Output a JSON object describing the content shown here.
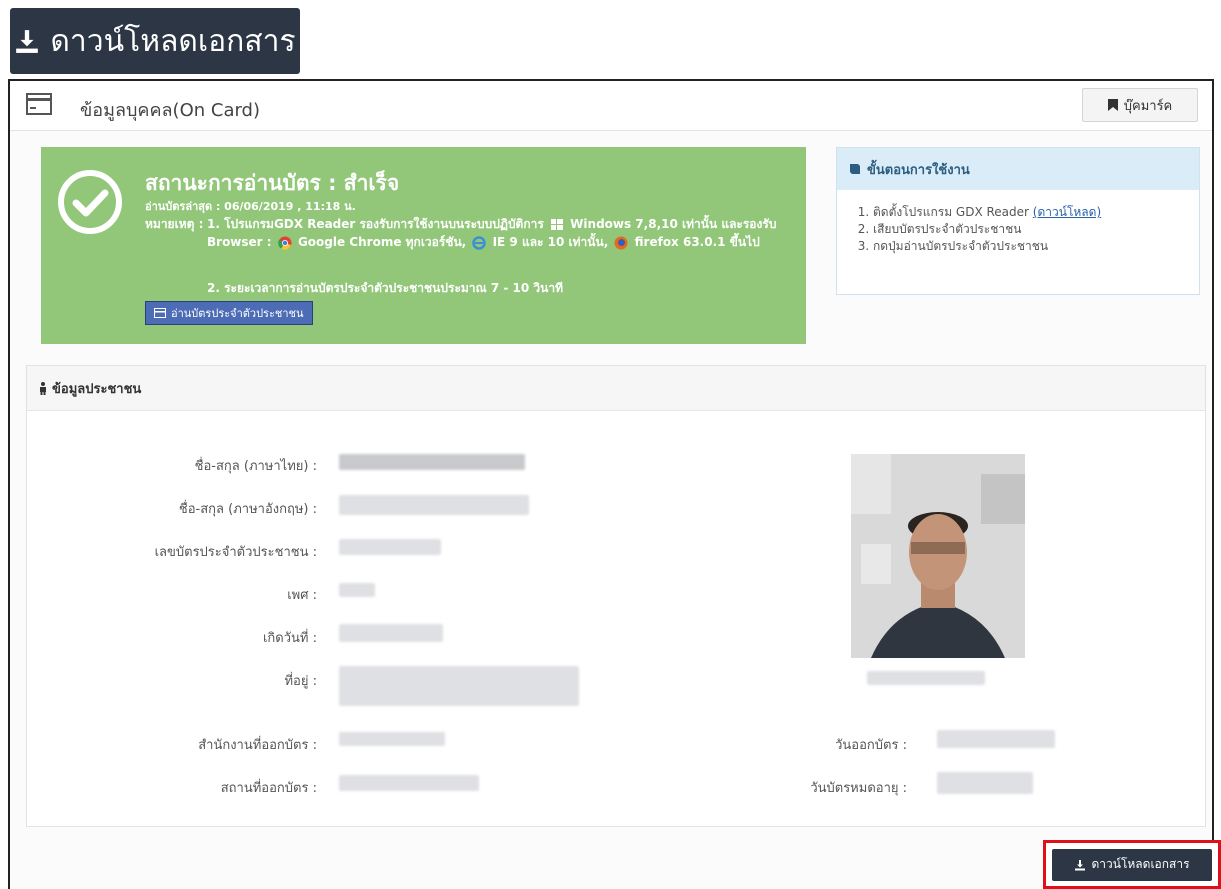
{
  "top_button": {
    "label": "ดาวน์โหลดเอกสาร",
    "icon": "download-icon"
  },
  "card": {
    "title": "ข้อมูลบุคคล(On Card)",
    "bookmark_label": "บุ๊คมาร์ค"
  },
  "status": {
    "title": "สถานะการอ่านบัตร : สำเร็จ",
    "last_read": "อ่านบัตรล่าสุด : 06/06/2019 , 11:18 น.",
    "remark_label": "หมายเหตุ :",
    "remark1_a": "1. โปรแกรมGDX Reader รองรับการใช้งานบนระบบปฏิบัติการ",
    "remark1_b": "Windows 7,8,10 เท่านั้น และรองรับ Browser :",
    "remark1_c": "Google Chrome ทุกเวอร์ชัน,",
    "remark1_d": "IE 9 และ 10 เท่านั้น,",
    "remark1_e": "firefox 63.0.1 ขึ้นไป",
    "remark2": "2. ระยะเวลาการอ่านบัตรประจำตัวประชาชนประมาณ 7 - 10 วินาที",
    "read_button": "อ่านบัตรประจำตัวประชาชน",
    "color": "#92c77a"
  },
  "steps": {
    "title": "ขั้นตอนการใช้งาน",
    "item1": "ติดตั้งโปรแกรม GDX Reader",
    "item1_link": "(ดาวน์โหลด)",
    "item2": "เสียบบัตรประจำตัวประชาชน",
    "item3": "กดปุ่มอ่านบัตรประจำตัวประชาชน"
  },
  "person": {
    "title": "ข้อมูลประชาชน",
    "labels": {
      "name_th": "ชื่อ-สกุล (ภาษาไทย) :",
      "name_en": "ชื่อ-สกุล (ภาษาอังกฤษ) :",
      "id_number": "เลขบัตรประจำตัวประชาชน :",
      "gender": "เพศ :",
      "birthdate": "เกิดวันที่ :",
      "address": "ที่อยู่ :",
      "issue_office": "สำนักงานที่ออกบัตร :",
      "issue_place": "สถานที่ออกบัตร :",
      "issue_date": "วันออกบัตร :",
      "expiry_date": "วันบัตรหมดอายุ :"
    }
  },
  "bottom_button": {
    "label": "ดาวน์โหลดเอกสาร",
    "highlight_color": "#e0101b"
  }
}
